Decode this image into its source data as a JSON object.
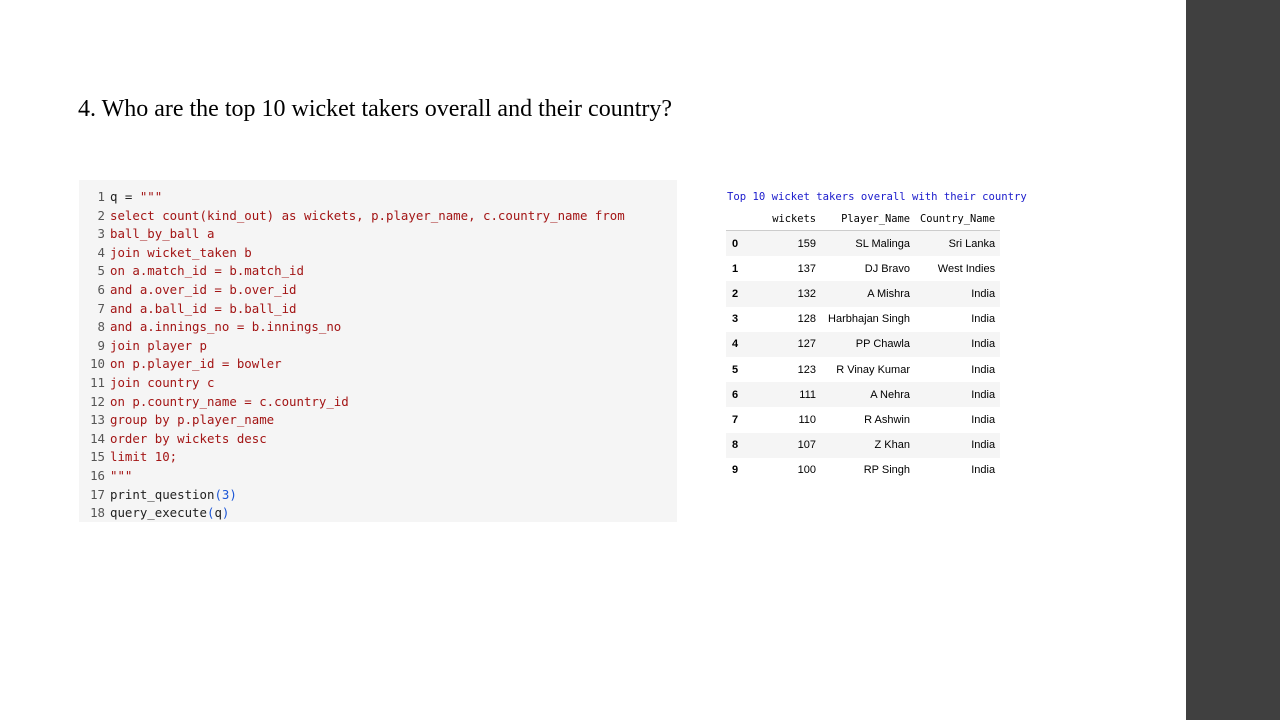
{
  "title": "4. Who are the top 10 wicket takers overall and their country?",
  "code": [
    {
      "n": "1",
      "parts": [
        {
          "t": "q = ",
          "c": "plain"
        },
        {
          "t": "\"\"\"",
          "c": "str"
        }
      ]
    },
    {
      "n": "2",
      "parts": [
        {
          "t": "select count(kind_out) as wickets, p.player_name, c.country_name from",
          "c": "str"
        }
      ]
    },
    {
      "n": "3",
      "parts": [
        {
          "t": "ball_by_ball a",
          "c": "str"
        }
      ]
    },
    {
      "n": "4",
      "parts": [
        {
          "t": "join wicket_taken b",
          "c": "str"
        }
      ]
    },
    {
      "n": "5",
      "parts": [
        {
          "t": "on a.match_id = b.match_id",
          "c": "str"
        }
      ]
    },
    {
      "n": "6",
      "parts": [
        {
          "t": "and a.over_id = b.over_id",
          "c": "str"
        }
      ]
    },
    {
      "n": "7",
      "parts": [
        {
          "t": "and a.ball_id = b.ball_id",
          "c": "str"
        }
      ]
    },
    {
      "n": "8",
      "parts": [
        {
          "t": "and a.innings_no = b.innings_no",
          "c": "str"
        }
      ]
    },
    {
      "n": "9",
      "parts": [
        {
          "t": "join player p",
          "c": "str"
        }
      ]
    },
    {
      "n": "10",
      "parts": [
        {
          "t": "on p.player_id = bowler",
          "c": "str"
        }
      ]
    },
    {
      "n": "11",
      "parts": [
        {
          "t": "join country c",
          "c": "str"
        }
      ]
    },
    {
      "n": "12",
      "parts": [
        {
          "t": "on p.country_name = c.country_id",
          "c": "str"
        }
      ]
    },
    {
      "n": "13",
      "parts": [
        {
          "t": "group by p.player_name",
          "c": "str"
        }
      ]
    },
    {
      "n": "14",
      "parts": [
        {
          "t": "order by wickets desc",
          "c": "str"
        }
      ]
    },
    {
      "n": "15",
      "parts": [
        {
          "t": "limit 10;",
          "c": "str"
        }
      ]
    },
    {
      "n": "16",
      "parts": [
        {
          "t": "\"\"\"",
          "c": "str"
        }
      ]
    },
    {
      "n": "17",
      "parts": [
        {
          "t": "print_question",
          "c": "plain"
        },
        {
          "t": "(3)",
          "c": "num"
        }
      ]
    },
    {
      "n": "18",
      "parts": [
        {
          "t": "query_execute",
          "c": "plain"
        },
        {
          "t": "(",
          "c": "num"
        },
        {
          "t": "q",
          "c": "plain"
        },
        {
          "t": ")",
          "c": "num"
        }
      ]
    }
  ],
  "result": {
    "title": "Top 10 wicket takers overall with their country",
    "columns": [
      "",
      "wickets",
      "Player_Name",
      "Country_Name"
    ],
    "rows": [
      [
        "0",
        "159",
        "SL Malinga",
        "Sri Lanka"
      ],
      [
        "1",
        "137",
        "DJ Bravo",
        "West Indies"
      ],
      [
        "2",
        "132",
        "A Mishra",
        "India"
      ],
      [
        "3",
        "128",
        "Harbhajan Singh",
        "India"
      ],
      [
        "4",
        "127",
        "PP Chawla",
        "India"
      ],
      [
        "5",
        "123",
        "R Vinay Kumar",
        "India"
      ],
      [
        "6",
        "111",
        "A Nehra",
        "India"
      ],
      [
        "7",
        "110",
        "R Ashwin",
        "India"
      ],
      [
        "8",
        "107",
        "Z Khan",
        "India"
      ],
      [
        "9",
        "100",
        "RP Singh",
        "India"
      ]
    ]
  },
  "colors": {
    "string": "#a31515",
    "code_text": "#212121",
    "number_paren": "#1a55d6",
    "result_title": "#1a1acc",
    "code_background": "#f5f5f5",
    "side_bar": "#404040"
  }
}
